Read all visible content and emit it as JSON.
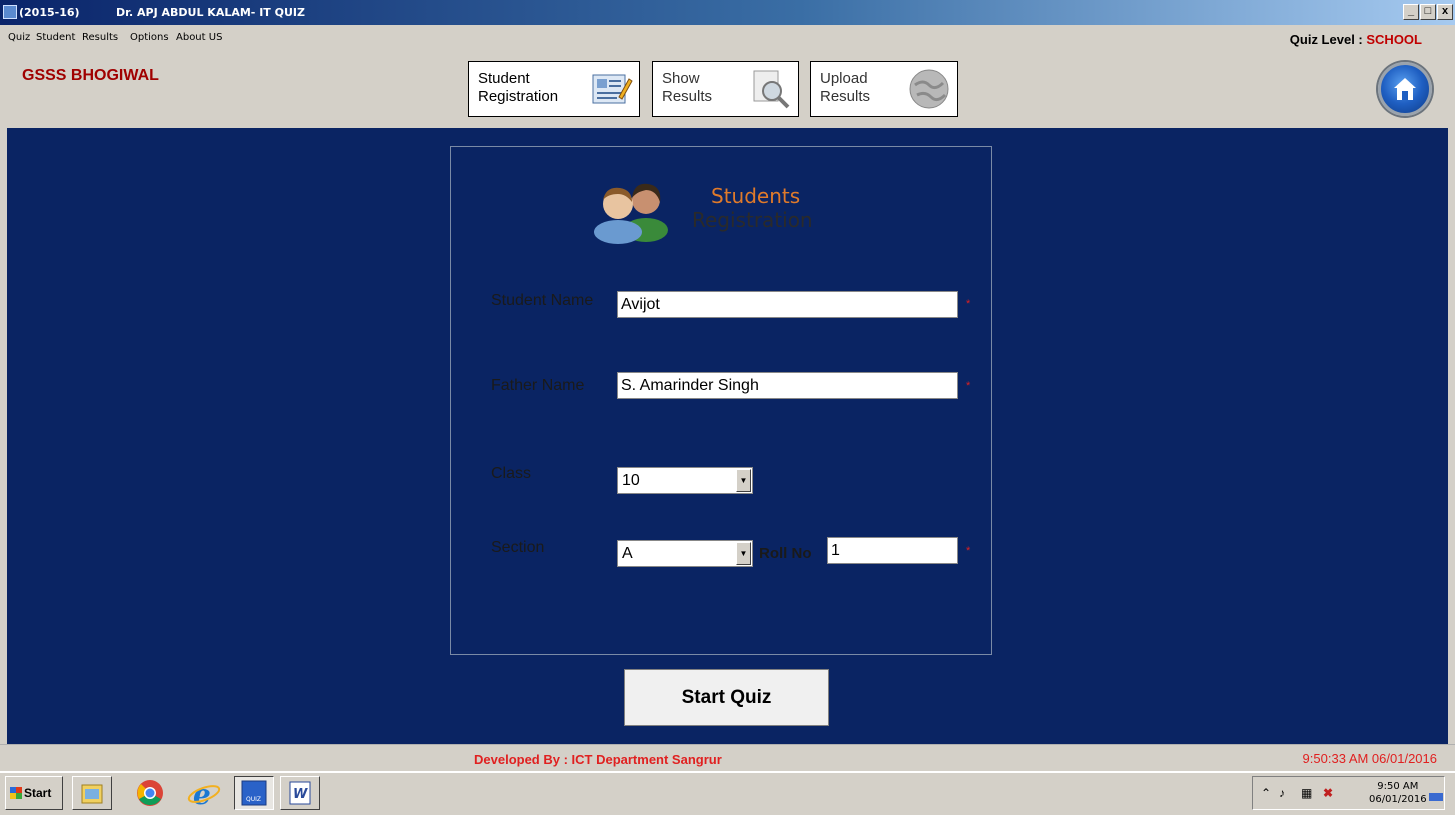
{
  "titlebar": {
    "session": "(2015-16)",
    "title": "Dr. APJ ABDUL KALAM- IT QUIZ",
    "buttons": {
      "minimize": "_",
      "maximize": "□",
      "close": "x"
    }
  },
  "menu": {
    "items": [
      "Quiz",
      "Student",
      "Results",
      "Options",
      "About US"
    ],
    "quiz_level_label": "Quiz Level :",
    "quiz_level_value": "SCHOOL"
  },
  "header": {
    "school": "GSSS BHOGIWAL",
    "tools": [
      {
        "line1": "Student",
        "line2": "Registration",
        "icon": "registration-form-icon"
      },
      {
        "line1": "Show",
        "line2": "Results",
        "icon": "magnifier-document-icon"
      },
      {
        "line1": "Upload",
        "line2": "Results",
        "icon": "globe-upload-icon"
      }
    ],
    "home_icon": "home-icon"
  },
  "form": {
    "logo_line1": "Students",
    "logo_line2": "Registration",
    "student_name_label": "Student Name",
    "student_name_value": "Avijot",
    "father_name_label": "Father Name",
    "father_name_value": "S. Amarinder Singh",
    "class_label": "Class",
    "class_value": "10",
    "section_label": "Section",
    "section_value": "A",
    "roll_label": "Roll No",
    "roll_value": "1",
    "required_mark": "*",
    "start_button": "Start Quiz"
  },
  "status": {
    "developer": "Developed By :  ICT Department Sangrur",
    "clock": "9:50:33 AM   06/01/2016"
  },
  "taskbar": {
    "start_label": "Start",
    "apps": [
      "file-manager-icon",
      "chrome-icon",
      "internet-explorer-icon",
      "quiz-app-icon",
      "word-icon"
    ],
    "tray_time": "9:50 AM",
    "tray_date": "06/01/2016"
  },
  "colors": {
    "main_bg": "#0a2463",
    "accent_red": "#e02020",
    "school_red": "#a00000",
    "logo_orange": "#e07a2a"
  }
}
